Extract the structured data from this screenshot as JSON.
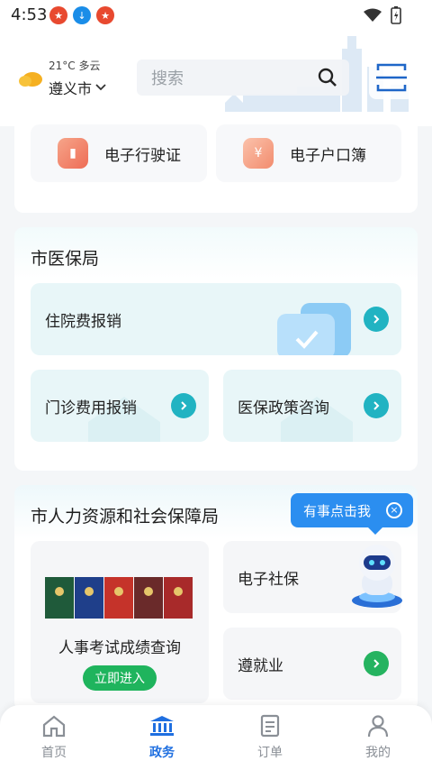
{
  "status_bar": {
    "time": "4:53"
  },
  "header": {
    "weather": "21°C 多云",
    "city": "遵义市",
    "search_placeholder": "搜索"
  },
  "top_services": [
    {
      "label": "电子行驶证",
      "color": "#f07a5a"
    },
    {
      "label": "电子户口簿",
      "color": "#f49a7c"
    }
  ],
  "medical": {
    "title": "市医保局",
    "items": [
      "住院费报销",
      "门诊费用报销",
      "医保政策咨询"
    ]
  },
  "hr": {
    "title": "市人力资源和社会保障局",
    "exam_label": "人事考试成绩查询",
    "enter_button": "立即进入",
    "items": [
      "电子社保",
      "遵就业"
    ]
  },
  "assistant_bubble": "有事点击我",
  "tabs": [
    {
      "label": "首页",
      "icon": "home-icon",
      "active": false
    },
    {
      "label": "政务",
      "icon": "government-icon",
      "active": true
    },
    {
      "label": "订单",
      "icon": "order-icon",
      "active": false
    },
    {
      "label": "我的",
      "icon": "profile-icon",
      "active": false
    }
  ],
  "colors": {
    "accent": "#1f6fe0",
    "teal": "#21b3c2",
    "green": "#25b360",
    "bubble": "#2b8ef0"
  }
}
